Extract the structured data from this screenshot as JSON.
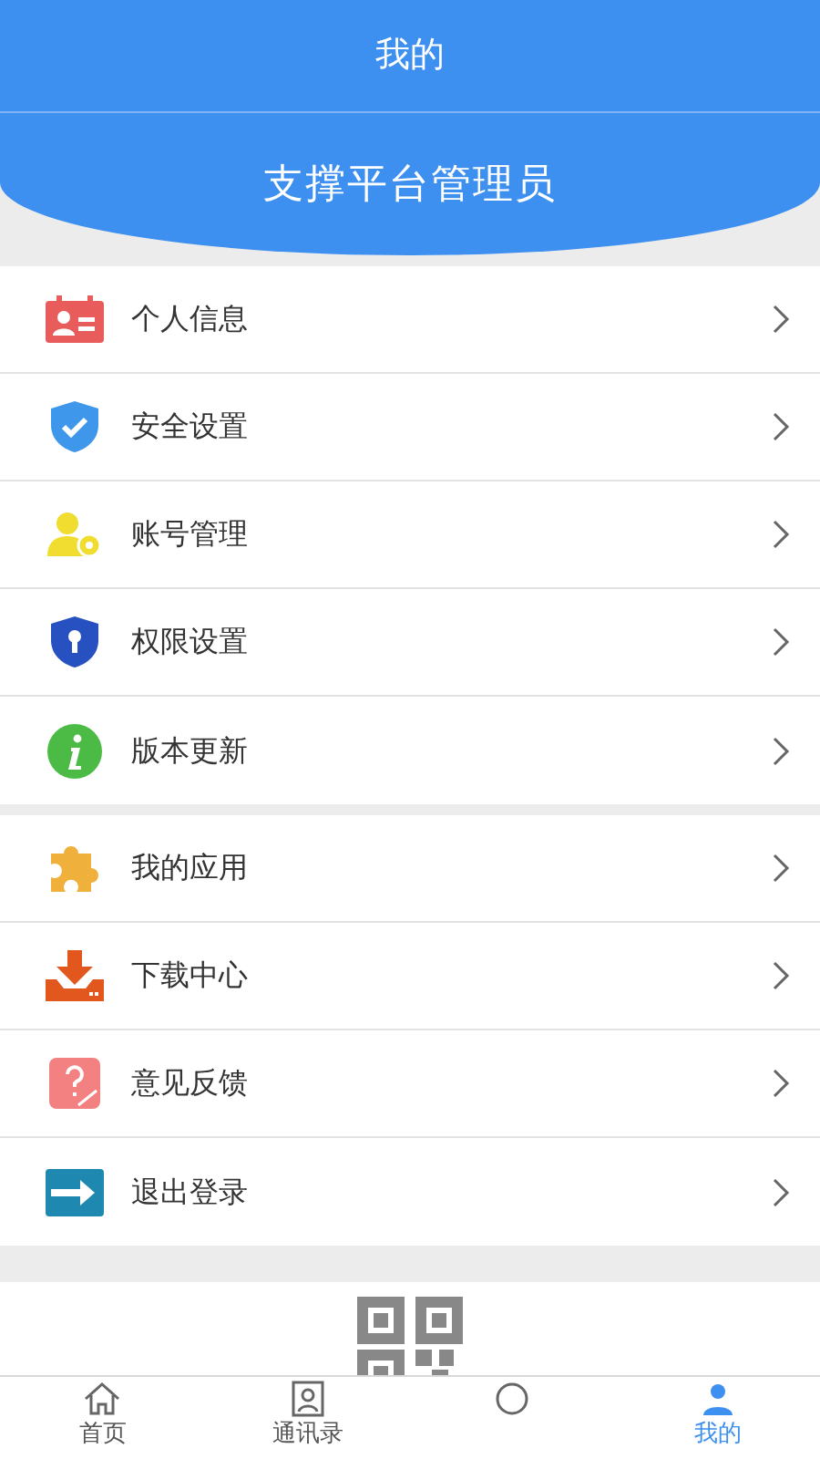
{
  "header": {
    "title": "我的",
    "user_name": "支撑平台管理员"
  },
  "menu_groups": [
    {
      "items": [
        {
          "label": "个人信息"
        },
        {
          "label": "安全设置"
        },
        {
          "label": "账号管理"
        },
        {
          "label": "权限设置"
        },
        {
          "label": "版本更新"
        }
      ]
    },
    {
      "items": [
        {
          "label": "我的应用"
        },
        {
          "label": "下载中心"
        },
        {
          "label": "意见反馈"
        },
        {
          "label": "退出登录"
        }
      ]
    }
  ],
  "tab_bar": [
    {
      "label": "首页",
      "selected": false
    },
    {
      "label": "通讯录",
      "selected": false
    },
    {
      "selected": false
    },
    {
      "label": "我的",
      "selected": true
    }
  ]
}
